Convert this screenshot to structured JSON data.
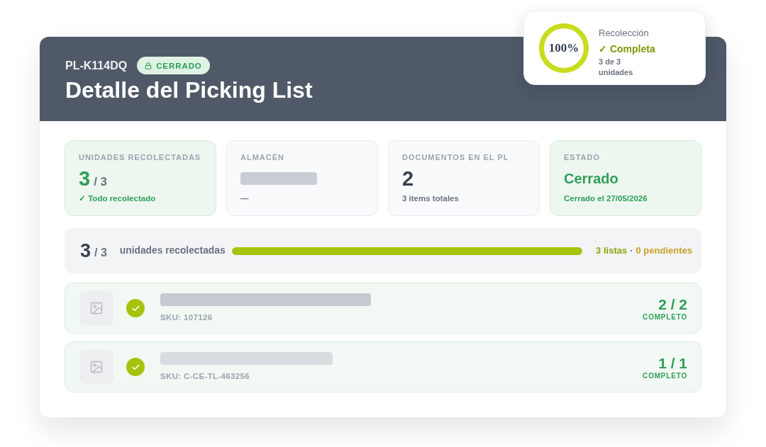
{
  "header": {
    "code": "PL-K114DQ",
    "badge": {
      "label": "CERRADO"
    },
    "title": "Detalle del Picking List"
  },
  "summary_popup": {
    "ring_label": "100%",
    "level": 1,
    "title": "Recolección",
    "status": "✓ Completa",
    "detail": "3 de 3 unidades"
  },
  "stats": [
    {
      "kind": "fraction",
      "label": "UNIDADES RECOLECTADAS",
      "value": "3",
      "total": "/ 3",
      "note": "✓ Todo recolectado",
      "highlight": true
    },
    {
      "kind": "placeholder",
      "label": "ALMACÉN",
      "note": "—",
      "highlight": false
    },
    {
      "kind": "number",
      "label": "DOCUMENTOS EN EL PL",
      "value": "2",
      "note": "3 items totales",
      "highlight": false
    },
    {
      "kind": "status",
      "label": "ESTADO",
      "value": "Cerrado",
      "note": "Cerrado el 27/05/2026",
      "highlight": true
    }
  ],
  "progress": {
    "value": "3",
    "total": "/ 3",
    "label": "unidades recolectadas",
    "level": 1,
    "lists": "3 listas",
    "separator": "·",
    "pending": "0 pendientes"
  },
  "items": [
    {
      "sku": "SKU: 107126",
      "picked": "2 / 2",
      "status": "COMPLETO",
      "done": true
    },
    {
      "sku": "SKU: C-CE-TL-463256",
      "picked": "1 / 1",
      "status": "COMPLETO",
      "done": true
    }
  ]
}
